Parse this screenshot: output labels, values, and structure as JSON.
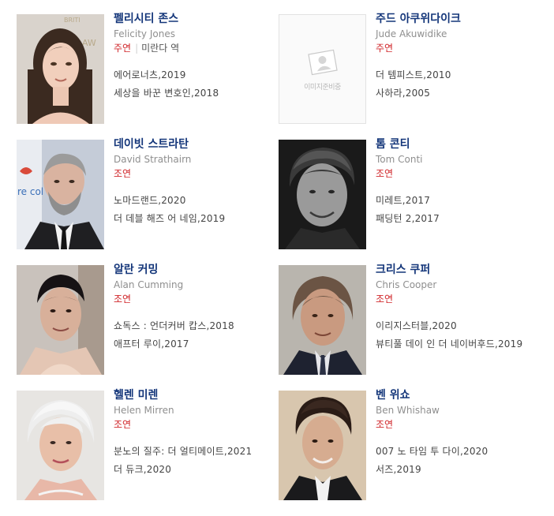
{
  "cast": [
    {
      "name_ko": "펠리시티 존스",
      "name_en": "Felicity Jones",
      "role": "주연",
      "separator": "|",
      "character": "미란다 역",
      "works": [
        "에어로너츠,2019",
        "세상을 바꾼 변호인,2018"
      ],
      "photo": "felicity-jones-photo",
      "has_photo": true
    },
    {
      "name_ko": "주드 아쿠위다이크",
      "name_en": "Jude Akuwidike",
      "role": "주연",
      "works": [
        "더 템피스트,2010",
        "사하라,2005"
      ],
      "photo": "no-image",
      "has_photo": false,
      "no_image_label": "이미지준비중"
    },
    {
      "name_ko": "데이빗 스트라탄",
      "name_en": "David Strathairn",
      "role": "조연",
      "works": [
        "노마드랜드,2020",
        "더 데블 해즈 어 네임,2019"
      ],
      "photo": "david-strathairn-photo",
      "has_photo": true
    },
    {
      "name_ko": "톰 콘티",
      "name_en": "Tom Conti",
      "role": "조연",
      "works": [
        "미레트,2017",
        "패딩턴 2,2017"
      ],
      "photo": "tom-conti-photo",
      "has_photo": true
    },
    {
      "name_ko": "알란 커밍",
      "name_en": "Alan Cumming",
      "role": "조연",
      "works": [
        "쇼독스 : 언더커버 캅스,2018",
        "애프터 루이,2017"
      ],
      "photo": "alan-cumming-photo",
      "has_photo": true
    },
    {
      "name_ko": "크리스 쿠퍼",
      "name_en": "Chris Cooper",
      "role": "조연",
      "works": [
        "이리지스터블,2020",
        "뷰티풀 데이 인 더 네이버후드,2019"
      ],
      "photo": "chris-cooper-photo",
      "has_photo": true
    },
    {
      "name_ko": "헬렌 미렌",
      "name_en": "Helen Mirren",
      "role": "조연",
      "works": [
        "분노의 질주: 더 얼티메이트,2021",
        "더 듀크,2020"
      ],
      "photo": "helen-mirren-photo",
      "has_photo": true
    },
    {
      "name_ko": "벤 위쇼",
      "name_en": "Ben Whishaw",
      "role": "조연",
      "works": [
        "007 노 타임 투 다이,2020",
        "서즈,2019"
      ],
      "photo": "ben-whishaw-photo",
      "has_photo": true
    }
  ],
  "colors": {
    "name": "#14367a",
    "role": "#d0262a",
    "english_name": "#8f8f8f",
    "work": "#444444"
  }
}
